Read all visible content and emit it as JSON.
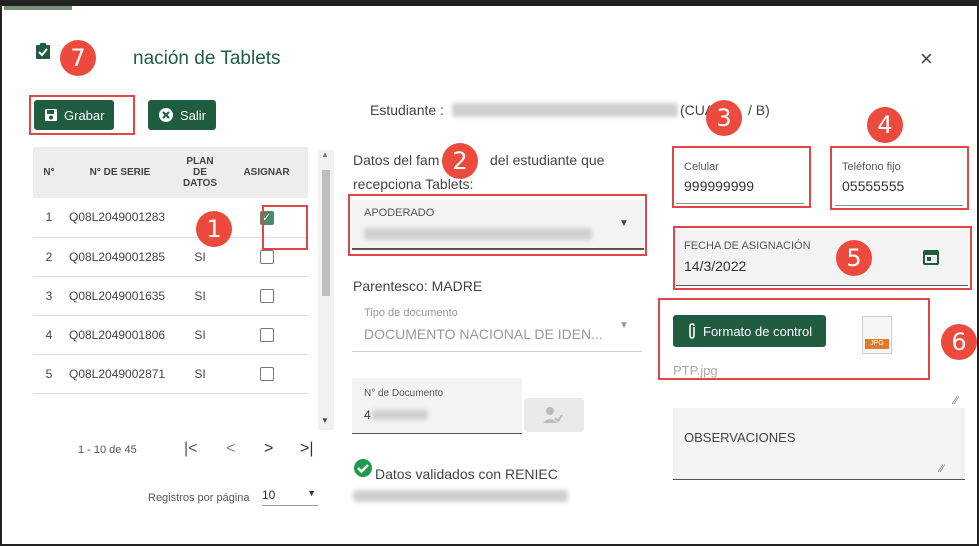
{
  "dialog": {
    "title": "nación de Tablets",
    "close": "×"
  },
  "toolbar": {
    "save_label": "Grabar",
    "exit_label": "Salir"
  },
  "table": {
    "headers": [
      "N°",
      "N° DE SERIE",
      "PLAN DE DATOS",
      "ASIGNAR"
    ],
    "rows": [
      {
        "n": "1",
        "serie": "Q08L2049001283",
        "plan": "",
        "checked": true
      },
      {
        "n": "2",
        "serie": "Q08L2049001285",
        "plan": "SI",
        "checked": false
      },
      {
        "n": "3",
        "serie": "Q08L2049001635",
        "plan": "SI",
        "checked": false
      },
      {
        "n": "4",
        "serie": "Q08L2049001806",
        "plan": "SI",
        "checked": false
      },
      {
        "n": "5",
        "serie": "Q08L2049002871",
        "plan": "SI",
        "checked": false
      }
    ]
  },
  "pager": {
    "range": "1 - 10 de 45",
    "per_page_label": "Registros por página",
    "per_page_value": "10"
  },
  "student": {
    "label": "Estudiante :",
    "suffix": "(CUA",
    "suffix2": "/ B)"
  },
  "family": {
    "prefix": "Datos del fam",
    "suffix": "del estudiante que",
    "line2": "recepciona Tablets:"
  },
  "apoderado_label": "APODERADO",
  "parentesco": "Parentesco: MADRE",
  "tipo_doc": {
    "label": "Tipo de documento",
    "value": "DOCUMENTO NACIONAL DE IDEN..."
  },
  "num_doc": {
    "label": "N° de Documento",
    "value": "4"
  },
  "reniec": "Datos validados con RENIEC",
  "celular": {
    "label": "Celular",
    "value": "999999999"
  },
  "telefono": {
    "label": "Teléfono fijo",
    "value": "05555555"
  },
  "fecha": {
    "label": "FECHA DE ASIGNACIÓN",
    "value": "14/3/2022"
  },
  "formato": {
    "button": "Formato de control",
    "file": "PTP.jpg",
    "ext": "JPG"
  },
  "observaciones": "OBSERVACIONES",
  "markers": [
    "7",
    "1",
    "2",
    "3",
    "4",
    "5",
    "6"
  ],
  "colors": {
    "primary": "#1f5c40",
    "marker": "#ec4a3c",
    "highlight": "#e04548"
  }
}
